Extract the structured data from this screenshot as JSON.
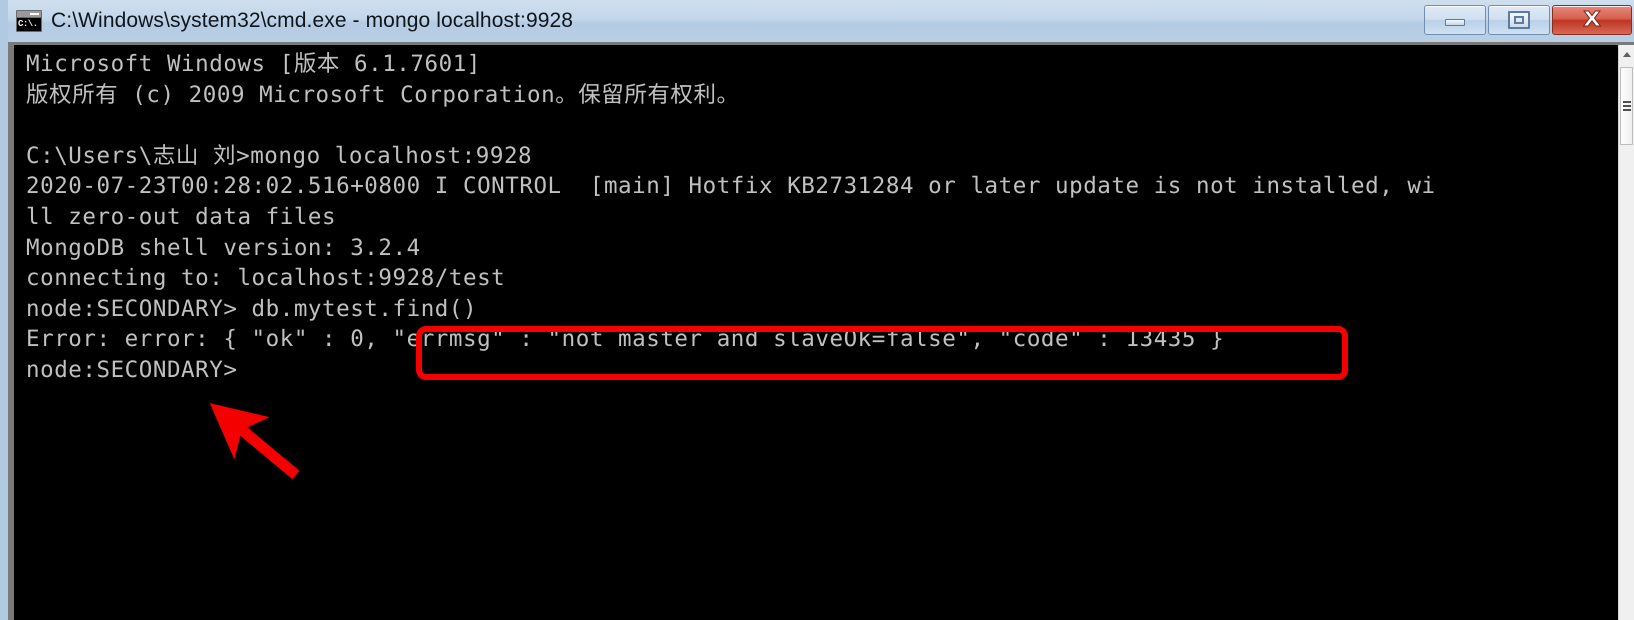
{
  "window": {
    "title": "C:\\Windows\\system32\\cmd.exe - mongo  localhost:9928",
    "icon": "cmd-console-icon",
    "icon_text": "C:\\.",
    "controls": {
      "minimize_label": "Minimize",
      "maximize_label": "Maximize",
      "close_label": "Close"
    },
    "colors": {
      "titlebar": "#b4cbe3",
      "console_bg": "#000000",
      "console_fg": "#c0c0c0",
      "close_button": "#bf3422",
      "annotation": "#f40000"
    }
  },
  "console": {
    "lines": [
      "Microsoft Windows [版本 6.1.7601]",
      "版权所有 (c) 2009 Microsoft Corporation。保留所有权利。",
      "",
      "C:\\Users\\志山 刘>mongo localhost:9928",
      "2020-07-23T00:28:02.516+0800 I CONTROL  [main] Hotfix KB2731284 or later update is not installed, wi",
      "ll zero-out data files",
      "MongoDB shell version: 3.2.4",
      "connecting to: localhost:9928/test",
      "node:SECONDARY> db.mytest.find()",
      "Error: error: { \"ok\" : 0, \"errmsg\" : \"not master and slaveOk=false\", \"code\" : 13435 }",
      "node:SECONDARY>"
    ],
    "prompt": "node:SECONDARY>",
    "command": "db.mytest.find()",
    "error_code": "13435",
    "error_message": "not master and slaveOk=false",
    "shell_version": "3.2.4",
    "connection": "localhost:9928/test",
    "scrollbar": {
      "up_arrow": "scroll-up-arrow-icon",
      "thumb": "scroll-thumb"
    }
  },
  "annotations": {
    "highlight_box": {
      "name": "error-highlight-box",
      "targets": "\"errmsg\" : \"not master and slaveOk=false\", \"code\" : 13435 }"
    },
    "arrow": {
      "name": "pointer-arrow",
      "points_at": "node:SECONDARY>"
    }
  }
}
